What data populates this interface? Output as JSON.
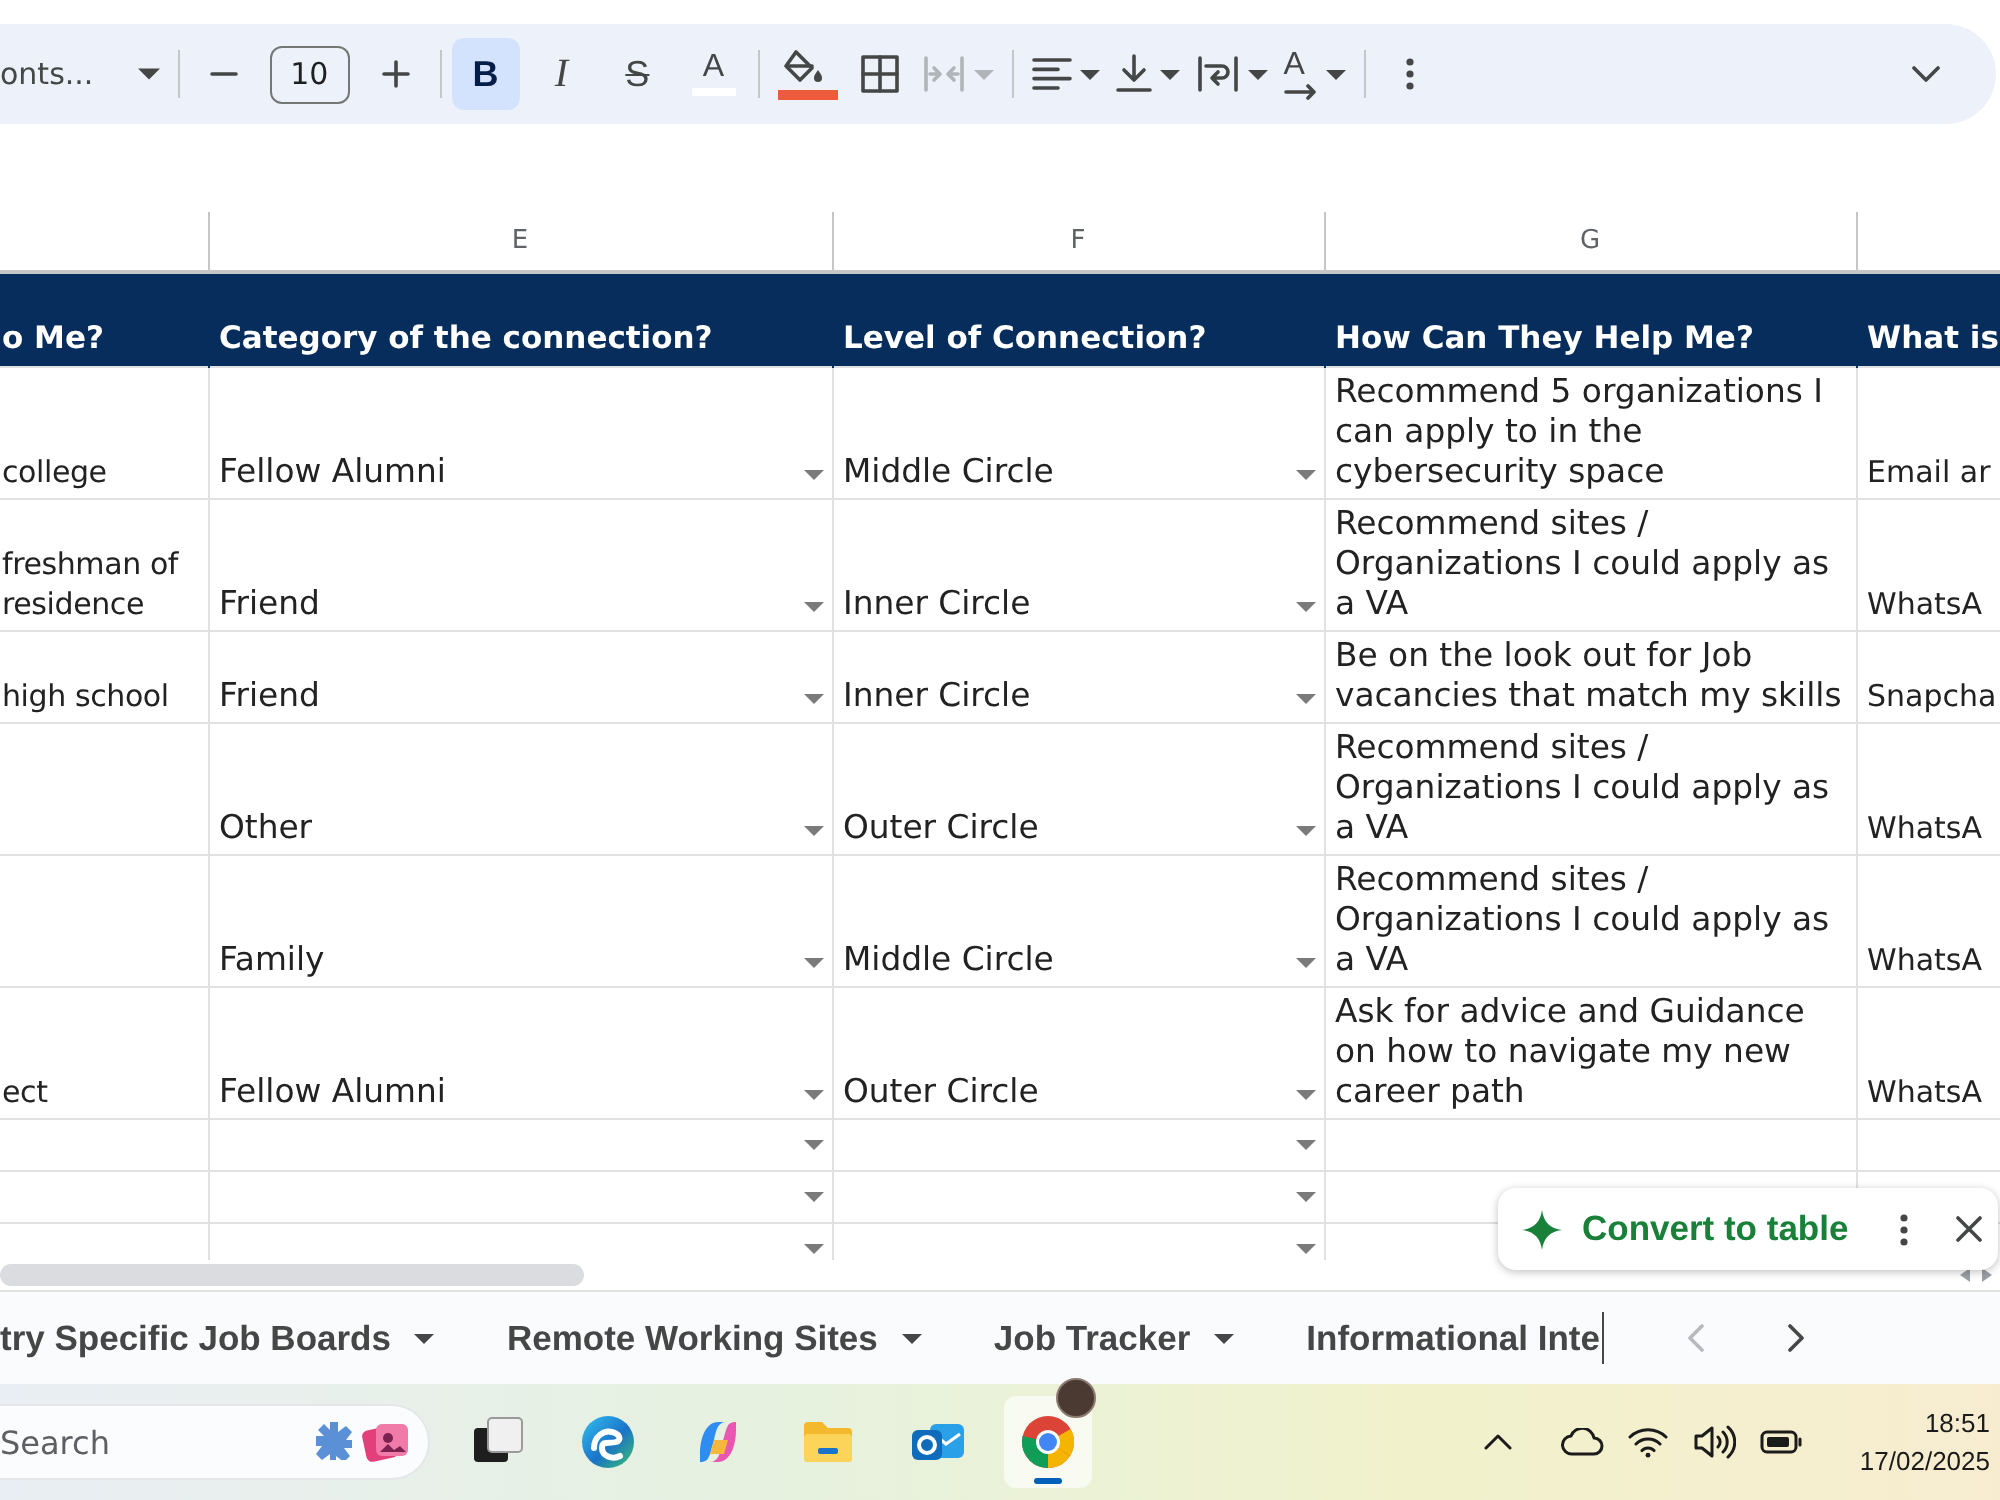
{
  "toolbar": {
    "font": "onts...",
    "font_size": "10",
    "styles": [
      {
        "kind": "bold",
        "symbol": "B",
        "selected": true
      },
      {
        "kind": "italic",
        "symbol": "I",
        "selected": false
      },
      {
        "kind": "strikethrough",
        "symbol": "S",
        "selected": false
      }
    ],
    "text_color": {
      "symbol": "A"
    },
    "merge": {
      "disabled": true
    },
    "rotation": {
      "symbol": "A"
    }
  },
  "sheet": {
    "columns": [
      {
        "kind": "text",
        "header": "o Me?"
      },
      {
        "kind": "dropdown",
        "letter": "E",
        "header": "Category of the connection?"
      },
      {
        "kind": "dropdown",
        "letter": "F",
        "header": "Level of Connection?"
      },
      {
        "kind": "text",
        "letter": "G",
        "header": "How Can They Help Me?"
      },
      {
        "kind": "text",
        "header": "What is"
      }
    ],
    "rows": [
      {
        "cells": [
          "college",
          "Fellow Alumni",
          "Middle Circle",
          "Recommend 5 organizations I can apply to in the cybersecurity space",
          "Email ar"
        ]
      },
      {
        "cells": [
          "freshman of residence",
          "Friend",
          "Inner Circle",
          "Recommend sites / Organizations I could apply as a VA",
          "WhatsA"
        ]
      },
      {
        "cells": [
          "high school",
          "Friend",
          "Inner Circle",
          "Be on the look out for Job vacancies that match my skills",
          "Snapcha"
        ]
      },
      {
        "cells": [
          null,
          "Other",
          "Outer Circle",
          "Recommend sites / Organizations I could apply as a VA",
          "WhatsA"
        ]
      },
      {
        "cells": [
          null,
          "Family",
          "Middle Circle",
          "Recommend sites / Organizations I could apply as a VA",
          "WhatsA"
        ]
      },
      {
        "cells": [
          "ect",
          "Fellow Alumni",
          "Outer Circle",
          "Ask for advice and Guidance on how to navigate my new career path",
          "WhatsA"
        ]
      }
    ]
  },
  "convert_chip": {
    "label": "Convert to table"
  },
  "sheet_tabs": [
    {
      "label": "try Specific Job Boards",
      "selected": false
    },
    {
      "label": "Remote Working Sites",
      "selected": false
    },
    {
      "label": "Job Tracker",
      "selected": false
    },
    {
      "label": "Informational Inte",
      "selected": false
    }
  ],
  "sheet_nav": {
    "previous": {
      "disabled": true
    },
    "next": {
      "disabled": false
    }
  },
  "taskbar": {
    "search": {
      "placeholder": "Search"
    },
    "apps": [
      {
        "active": false
      },
      {
        "active": false
      },
      {
        "active": false
      },
      {
        "active": false
      },
      {
        "active": false
      },
      {
        "active": true
      }
    ],
    "clock": {
      "time": "18:51",
      "date": "17/02/2025"
    }
  }
}
